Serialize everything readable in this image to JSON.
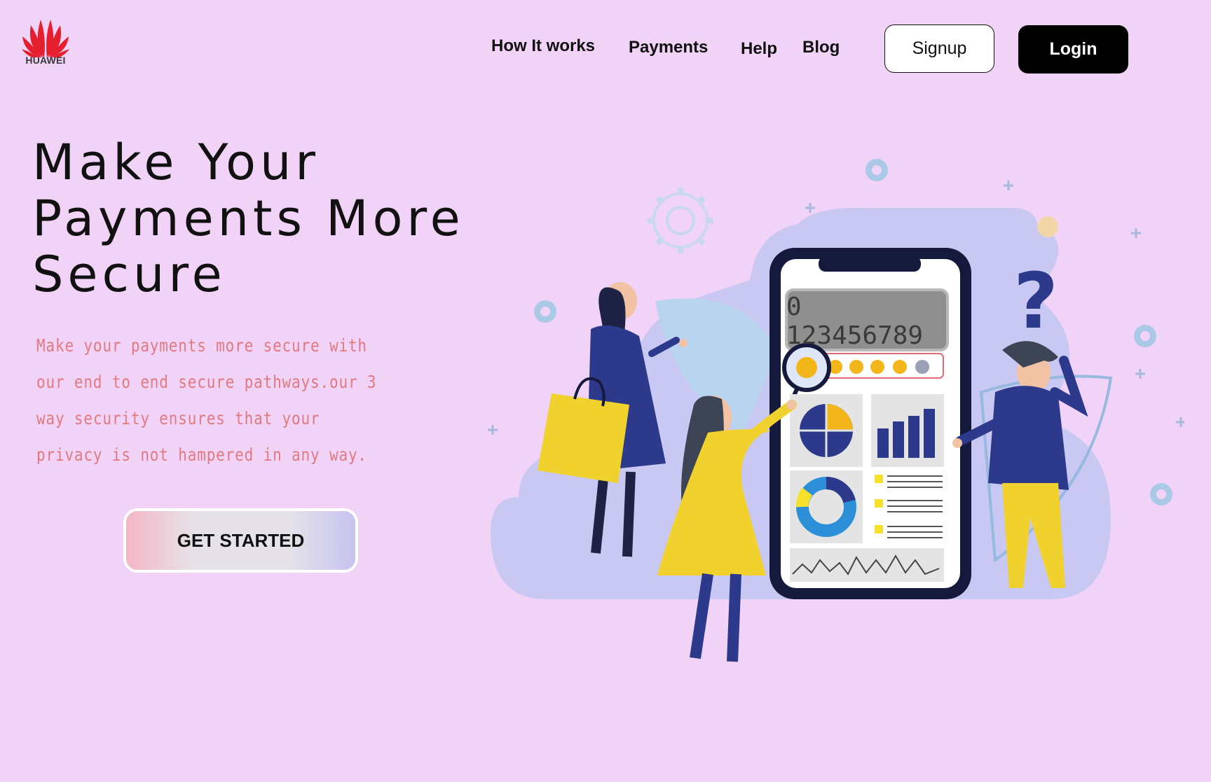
{
  "brand": {
    "name": "HUAWEI",
    "color": "#e4202e",
    "icon": "huawei-petal-logo-icon"
  },
  "nav": {
    "links": [
      "How It works",
      "Payments",
      "Help",
      "Blog"
    ],
    "signup_label": "Signup",
    "login_label": "Login"
  },
  "hero": {
    "title": "Make Your Payments More Secure",
    "description": "Make your payments more secure with our end to end secure pathways.our 3 way security ensures that your privacy is not hampered in any way.",
    "cta_label": "GET STARTED"
  },
  "illustration": {
    "phone_readout": "0 123456789",
    "rating_stars": 4,
    "rating_max": 5,
    "icons": [
      "gear-icon",
      "question-mark-icon",
      "magnifier-star-icon",
      "pie-chart-icon",
      "bar-chart-icon",
      "donut-chart-icon",
      "line-chart-icon",
      "shopping-bag-icon"
    ]
  },
  "colors": {
    "background": "#f0d3f7",
    "accent_text": "#e07a80",
    "navy": "#2d3a8c",
    "yellow": "#f0d12e"
  }
}
